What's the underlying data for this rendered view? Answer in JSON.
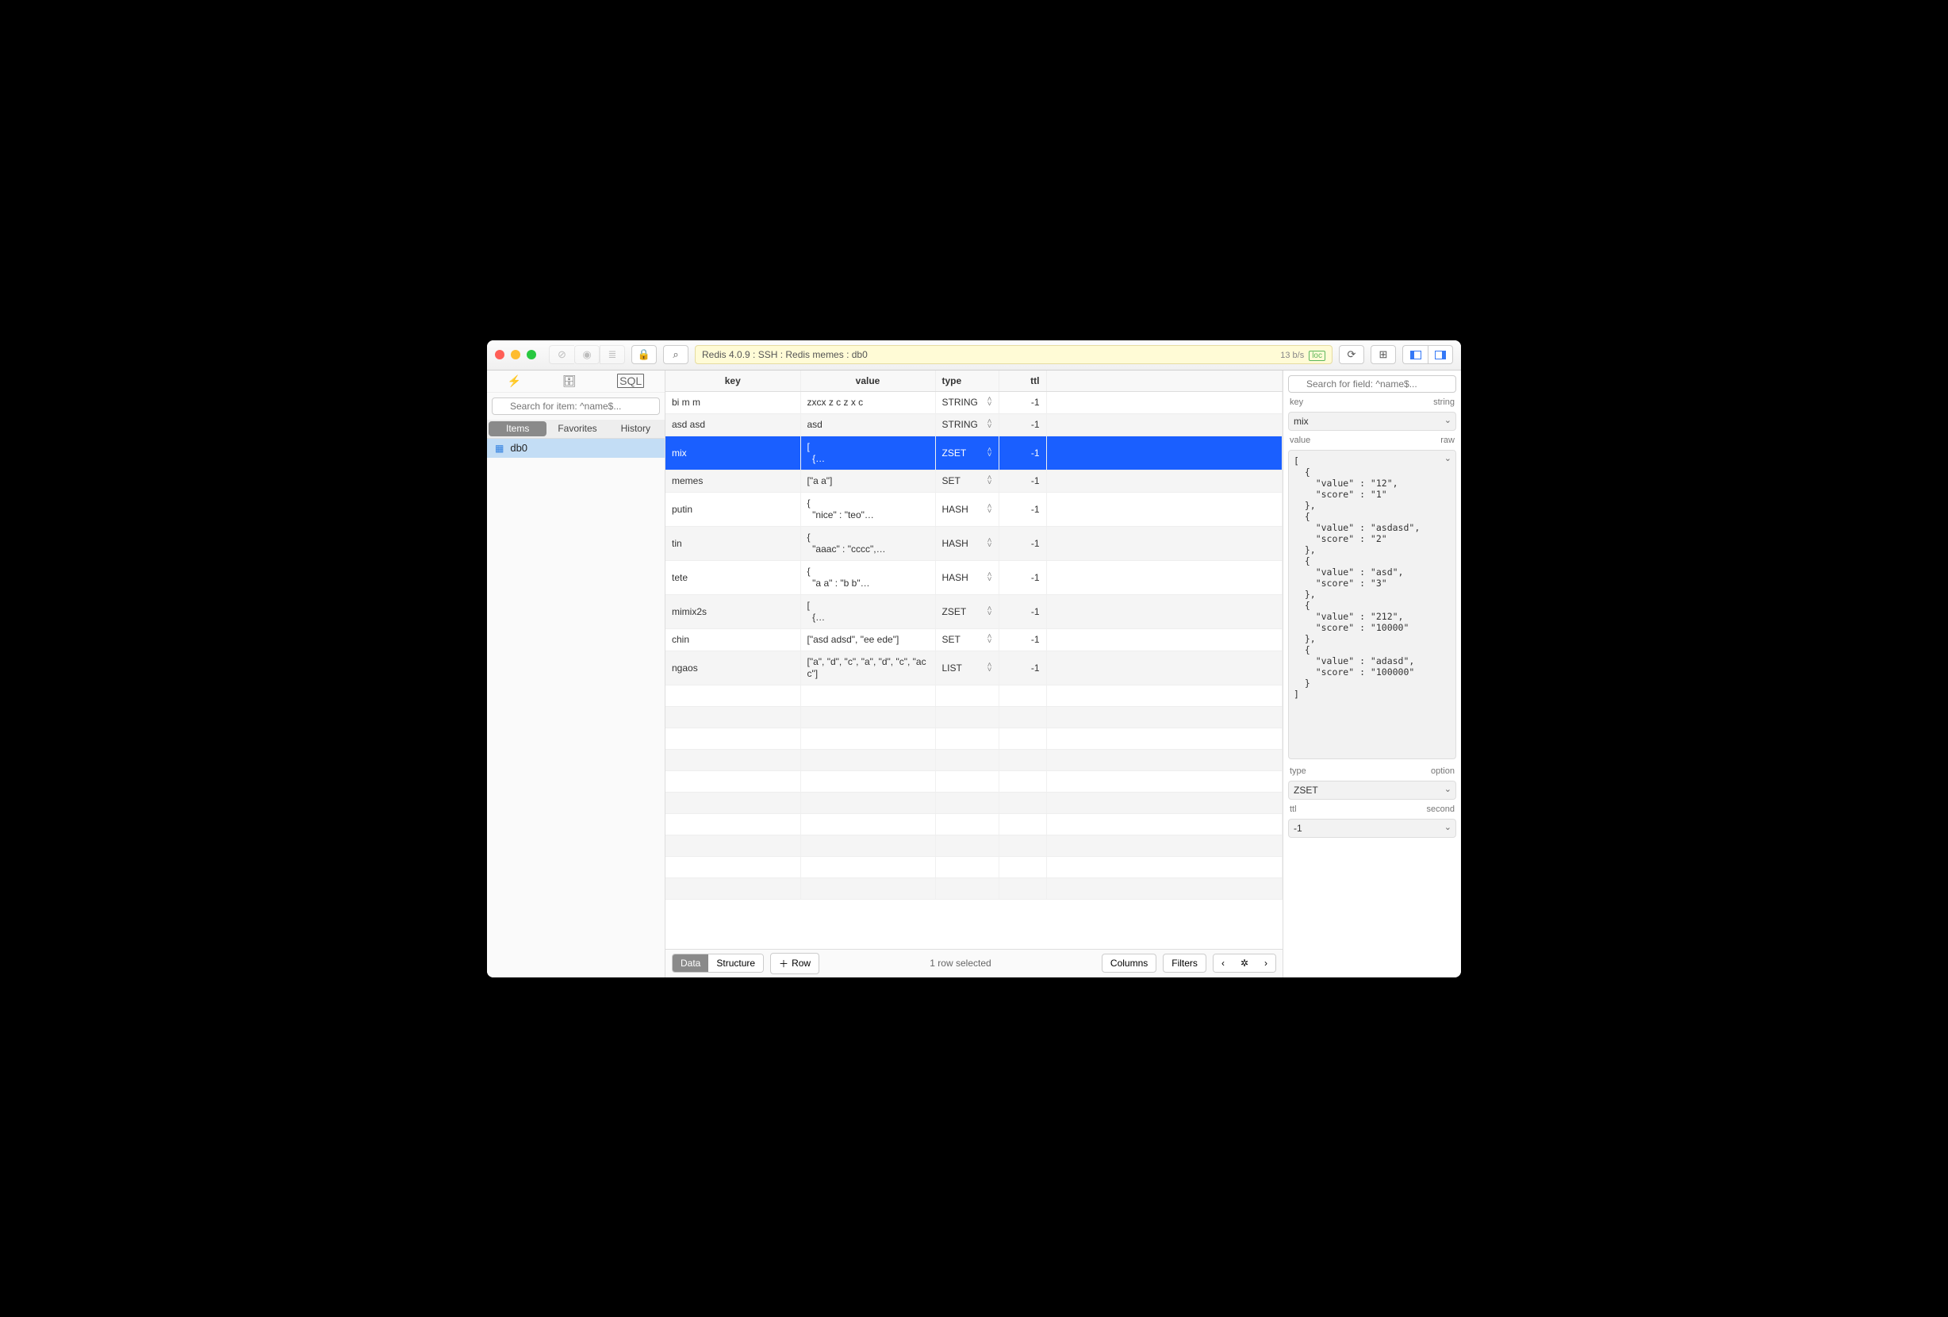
{
  "toolbar": {
    "breadcrumb": "Redis 4.0.9 : SSH : Redis memes : db0",
    "bps": "13 b/s",
    "loc": "loc"
  },
  "sidebar": {
    "search_placeholder": "Search for item: ^name$...",
    "tabs": [
      "Items",
      "Favorites",
      "History"
    ],
    "items": [
      {
        "label": "db0"
      }
    ]
  },
  "columns": {
    "key": "key",
    "value": "value",
    "type": "type",
    "ttl": "ttl"
  },
  "rows": [
    {
      "key": "bi m m",
      "value": "zxcx z c z x c",
      "type": "STRING",
      "ttl": "-1"
    },
    {
      "key": "asd asd",
      "value": "asd",
      "type": "STRING",
      "ttl": "-1"
    },
    {
      "key": "mix",
      "value": "[\n  {…",
      "type": "ZSET",
      "ttl": "-1",
      "selected": true
    },
    {
      "key": "memes",
      "value": "[\"a a\"]",
      "type": "SET",
      "ttl": "-1"
    },
    {
      "key": "putin",
      "value": "{\n  \"nice\" : \"teo\"…",
      "type": "HASH",
      "ttl": "-1"
    },
    {
      "key": "tin",
      "value": "{\n  \"aaac\" : \"cccc\",…",
      "type": "HASH",
      "ttl": "-1"
    },
    {
      "key": "tete",
      "value": "{\n  \"a a\" : \"b b\"…",
      "type": "HASH",
      "ttl": "-1"
    },
    {
      "key": "mimix2s",
      "value": "[\n  {…",
      "type": "ZSET",
      "ttl": "-1"
    },
    {
      "key": "chin",
      "value": "[\"asd adsd\", \"ee ede\"]",
      "type": "SET",
      "ttl": "-1"
    },
    {
      "key": "ngaos",
      "value": "[\"a\", \"d\", \"c\", \"a\", \"d\", \"c\", \"ac c\"]",
      "type": "LIST",
      "ttl": "-1"
    }
  ],
  "footer": {
    "seg": [
      "Data",
      "Structure"
    ],
    "add_row": "Row",
    "status": "1 row selected",
    "columns_btn": "Columns",
    "filters_btn": "Filters"
  },
  "inspector": {
    "search_placeholder": "Search for field: ^name$...",
    "key_label": "key",
    "key_type": "string",
    "key_value": "mix",
    "value_label": "value",
    "value_type": "raw",
    "value_text": "[\n  {\n    \"value\" : \"12\",\n    \"score\" : \"1\"\n  },\n  {\n    \"value\" : \"asdasd\",\n    \"score\" : \"2\"\n  },\n  {\n    \"value\" : \"asd\",\n    \"score\" : \"3\"\n  },\n  {\n    \"value\" : \"212\",\n    \"score\" : \"10000\"\n  },\n  {\n    \"value\" : \"adasd\",\n    \"score\" : \"100000\"\n  }\n]",
    "type_label": "type",
    "type_type": "option",
    "type_value": "ZSET",
    "ttl_label": "ttl",
    "ttl_type": "second",
    "ttl_value": "-1"
  }
}
